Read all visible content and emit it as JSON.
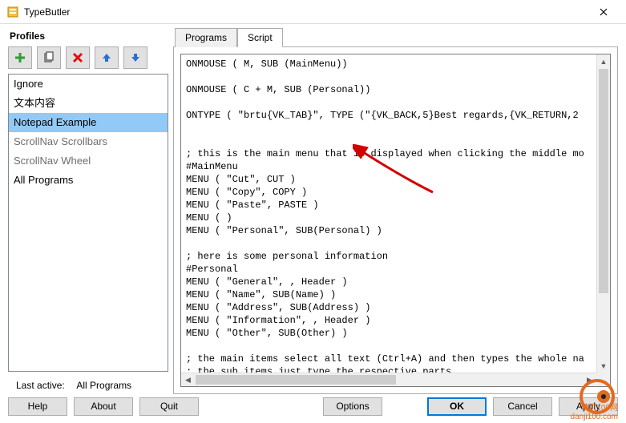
{
  "window": {
    "title": "TypeButler"
  },
  "profiles": {
    "header": "Profiles",
    "items": [
      {
        "label": "Ignore",
        "state": "normal"
      },
      {
        "label": "文本内容",
        "state": "normal"
      },
      {
        "label": "Notepad Example",
        "state": "selected"
      },
      {
        "label": "ScrollNav Scrollbars",
        "state": "disabled"
      },
      {
        "label": "ScrollNav Wheel",
        "state": "disabled"
      },
      {
        "label": "All Programs",
        "state": "normal"
      }
    ],
    "last_active_label": "Last active:",
    "last_active_value": "All Programs"
  },
  "tabs": {
    "programs": "Programs",
    "script": "Script"
  },
  "script_text": "ONMOUSE ( M, SUB (MainMenu))\n\nONMOUSE ( C + M, SUB (Personal))\n\nONTYPE ( \"brtu{VK_TAB}\", TYPE (\"{VK_BACK,5}Best regards,{VK_RETURN,2\n\n\n; this is the main menu that is displayed when clicking the middle mo\n#MainMenu\nMENU ( \"Cut\", CUT )\nMENU ( \"Copy\", COPY )\nMENU ( \"Paste\", PASTE )\nMENU ( )\nMENU ( \"Personal\", SUB(Personal) )\n\n; here is some personal information\n#Personal\nMENU ( \"General\", , Header )\nMENU ( \"Name\", SUB(Name) )\nMENU ( \"Address\", SUB(Address) )\nMENU ( \"Information\", , Header )\nMENU ( \"Other\", SUB(Other) )\n\n; the main items select all text (Ctrl+A) and then types the whole na\n; the sub items just type the respective parts",
  "footer": {
    "help": "Help",
    "about": "About",
    "quit": "Quit",
    "options": "Options",
    "ok": "OK",
    "cancel": "Cancel",
    "apply": "Apply"
  },
  "watermark": "单机100网\ndanji100.com"
}
